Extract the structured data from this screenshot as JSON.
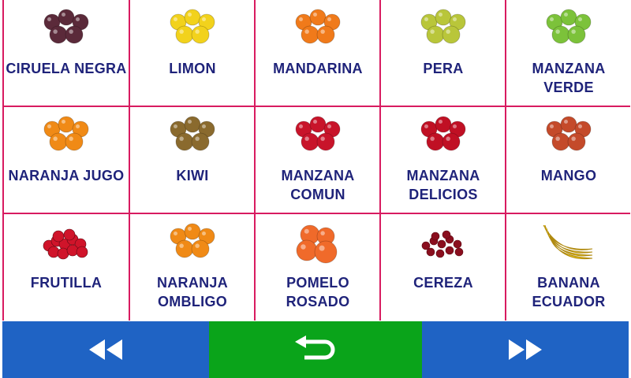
{
  "tiles": [
    {
      "id": "ciruela-negra",
      "lines": [
        "CIRUELA NEGRA"
      ],
      "icon": "plums-icon",
      "color": "#5b2a3a"
    },
    {
      "id": "limon",
      "lines": [
        "LIMON"
      ],
      "icon": "lemons-icon",
      "color": "#f2d21c"
    },
    {
      "id": "mandarina",
      "lines": [
        "MANDARINA"
      ],
      "icon": "tangerines-icon",
      "color": "#f07a1a"
    },
    {
      "id": "pera",
      "lines": [
        "PERA"
      ],
      "icon": "pears-icon",
      "color": "#b9c63a"
    },
    {
      "id": "manzana-verde",
      "lines": [
        "MANZANA VERDE"
      ],
      "icon": "green-apples-icon",
      "color": "#7cc23a"
    },
    {
      "id": "naranja-jugo",
      "lines": [
        "NARANJA JUGO"
      ],
      "icon": "oranges-icon",
      "color": "#f08a16"
    },
    {
      "id": "kiwi",
      "lines": [
        "KIWI"
      ],
      "icon": "kiwis-icon",
      "color": "#8a6a2e"
    },
    {
      "id": "manzana-comun",
      "lines": [
        "MANZANA",
        "COMUN"
      ],
      "icon": "red-apples-icon",
      "color": "#c8142a"
    },
    {
      "id": "manzana-delicios",
      "lines": [
        "MANZANA",
        "DELICIOS"
      ],
      "icon": "delicious-apples-icon",
      "color": "#c01024"
    },
    {
      "id": "mango",
      "lines": [
        "MANGO"
      ],
      "icon": "mangos-icon",
      "color": "#c44a2a"
    },
    {
      "id": "frutilla",
      "lines": [
        "FRUTILLA"
      ],
      "icon": "strawberries-icon",
      "color": "#d0142a"
    },
    {
      "id": "naranja-ombligo",
      "lines": [
        "NARANJA",
        "OMBLIGO"
      ],
      "icon": "navel-oranges-icon",
      "color": "#f08a16"
    },
    {
      "id": "pomelo-rosado",
      "lines": [
        "POMELO ROSADO"
      ],
      "icon": "grapefruits-icon",
      "color": "#f06a2a"
    },
    {
      "id": "cereza",
      "lines": [
        "CEREZA"
      ],
      "icon": "cherries-icon",
      "color": "#8a0e1e"
    },
    {
      "id": "banana-ecuador",
      "lines": [
        "BANANA",
        "ECUADOR"
      ],
      "icon": "bananas-icon",
      "color": "#f5d21a"
    }
  ],
  "nav": {
    "prev": {
      "icon": "rewind-icon",
      "color": "#1f63c4"
    },
    "back": {
      "icon": "return-icon",
      "color": "#0aa41a"
    },
    "next": {
      "icon": "fast-forward-icon",
      "color": "#1f63c4"
    }
  }
}
